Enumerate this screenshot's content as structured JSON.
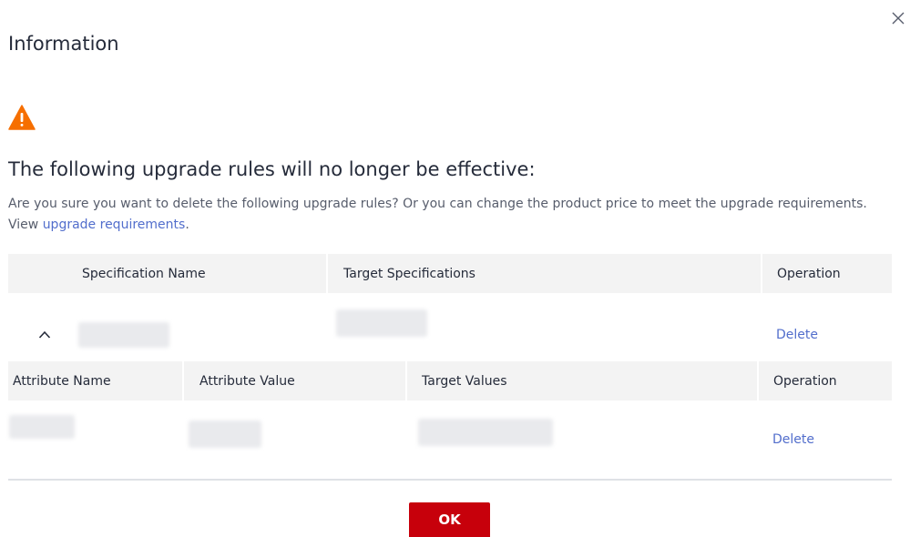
{
  "dialog": {
    "title": "Information",
    "close_icon": "close-icon",
    "warning_icon": "warning-triangle-icon",
    "headline": "The following upgrade rules will no longer be effective:",
    "description": "Are you sure you want to delete the following upgrade rules? Or you can change the product price to meet the upgrade requirements. View",
    "link_text": "upgrade requirements",
    "link_suffix": ".",
    "ok_label": "OK"
  },
  "spec_table": {
    "headers": [
      "Specification Name",
      "Target Specifications",
      "Operation"
    ],
    "rows": [
      {
        "expand_icon": "chevron-up-icon",
        "spec_name": "",
        "target_spec": "",
        "operation": "Delete"
      }
    ]
  },
  "attr_table": {
    "headers": [
      "Attribute Name",
      "Attribute Value",
      "Target Values",
      "Operation"
    ],
    "rows": [
      {
        "attribute_name": "",
        "attribute_value": "",
        "target_values": "",
        "operation": "Delete"
      }
    ]
  },
  "colors": {
    "primary_button": "#c7000b",
    "link": "#526ecc",
    "warning": "#f66f00",
    "header_bg": "#f3f3f3"
  }
}
